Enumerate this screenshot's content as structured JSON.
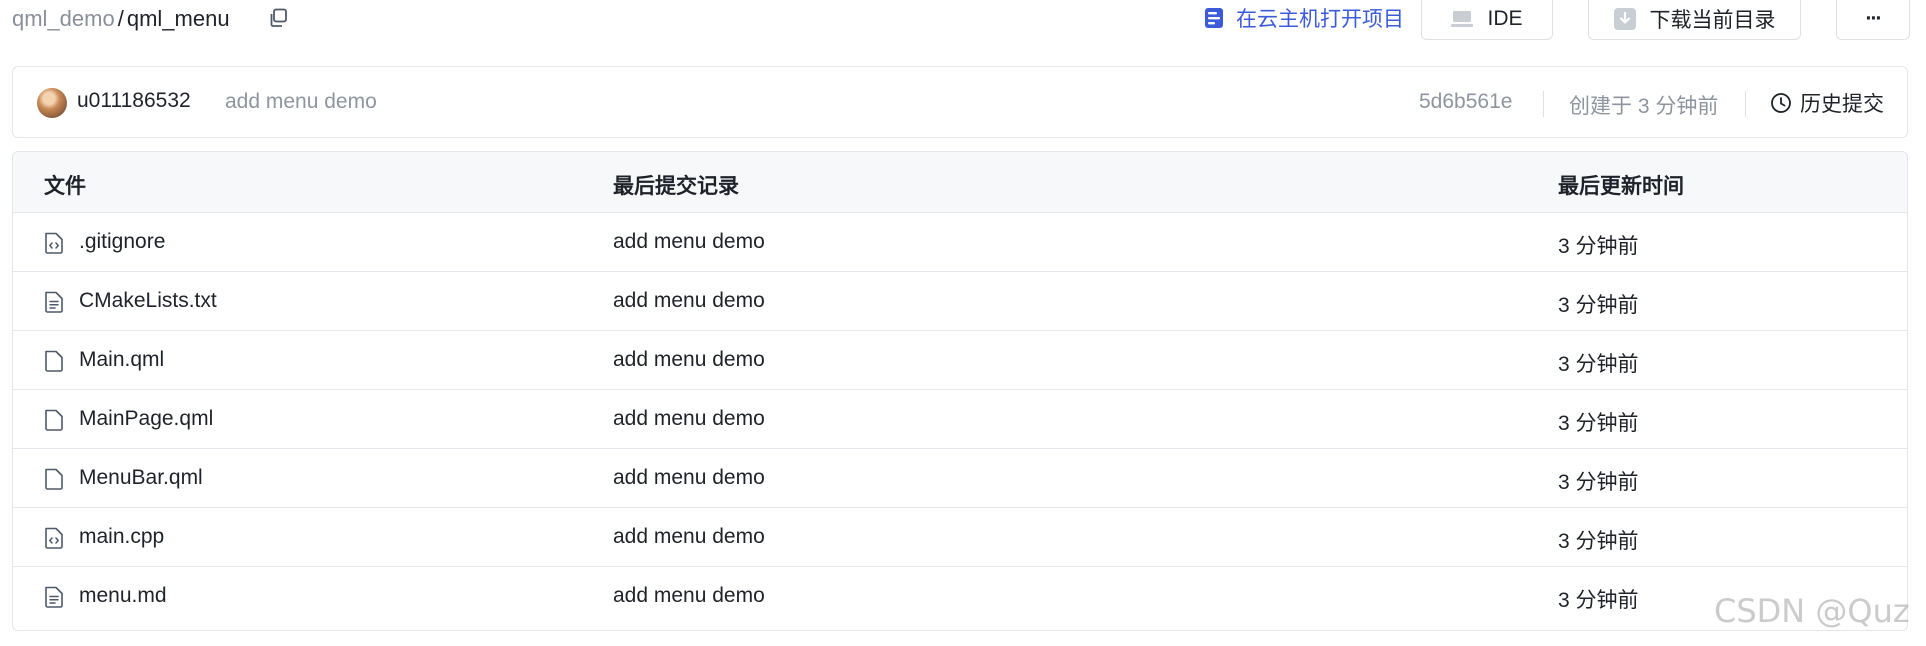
{
  "breadcrumb": {
    "repo": "qml_demo",
    "separator": "/",
    "folder": "qml_menu"
  },
  "actions": {
    "cloud_open": "在云主机打开项目",
    "ide": "IDE",
    "download": "下载当前目录",
    "more": "···"
  },
  "commit": {
    "author": "u011186532",
    "message": "add menu demo",
    "hash": "5d6b561e",
    "created": "创建于 3 分钟前",
    "history": "历史提交"
  },
  "table": {
    "headers": {
      "file": "文件",
      "last_commit": "最后提交记录",
      "last_update": "最后更新时间"
    },
    "rows": [
      {
        "name": ".gitignore",
        "icon": "code-file-icon",
        "message": "add menu demo",
        "time": "3 分钟前"
      },
      {
        "name": "CMakeLists.txt",
        "icon": "text-file-icon",
        "message": "add menu demo",
        "time": "3 分钟前"
      },
      {
        "name": "Main.qml",
        "icon": "file-icon",
        "message": "add menu demo",
        "time": "3 分钟前"
      },
      {
        "name": "MainPage.qml",
        "icon": "file-icon",
        "message": "add menu demo",
        "time": "3 分钟前"
      },
      {
        "name": "MenuBar.qml",
        "icon": "file-icon",
        "message": "add menu demo",
        "time": "3 分钟前"
      },
      {
        "name": "main.cpp",
        "icon": "code-file-icon",
        "message": "add menu demo",
        "time": "3 分钟前"
      },
      {
        "name": "menu.md",
        "icon": "text-file-icon",
        "message": "add menu demo",
        "time": "3 分钟前"
      }
    ]
  },
  "watermark": "CSDN @Quz",
  "colors": {
    "link_blue": "#3b5bdb",
    "muted_text": "#8f959e",
    "border": "#e5e6eb",
    "header_bg": "#f7f8fa"
  }
}
